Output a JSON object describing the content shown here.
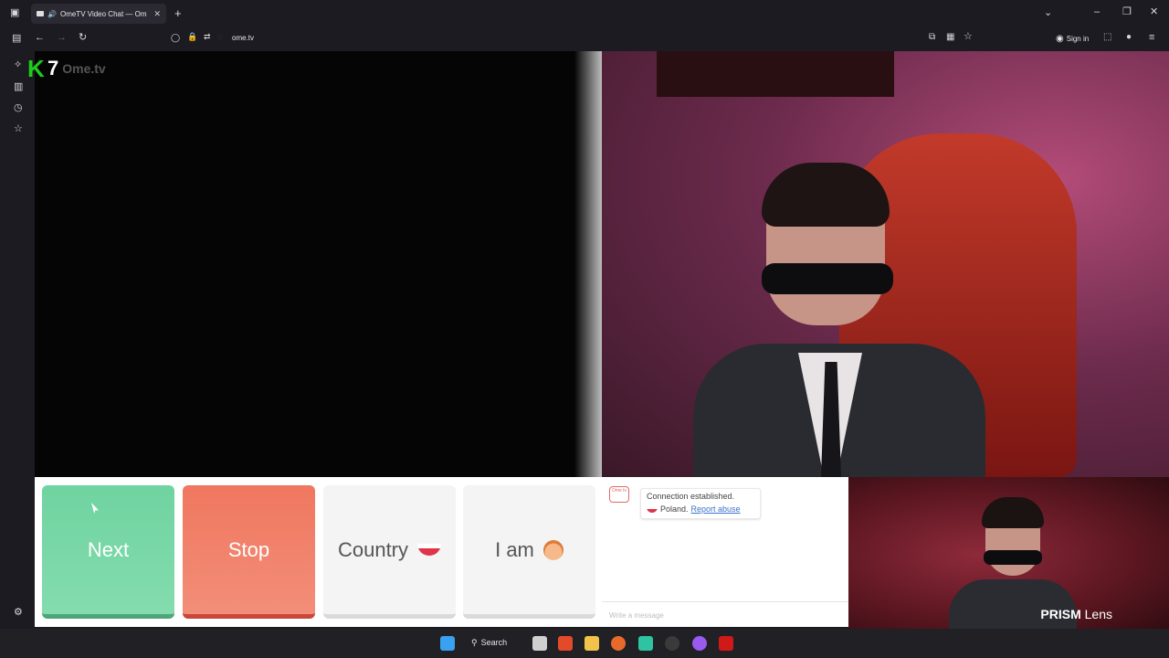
{
  "browser": {
    "tab_title": "OmeTV Video Chat — Om",
    "tab_close": "✕",
    "new_tab": "+",
    "url": "ome.tv",
    "signin_label": "Sign in"
  },
  "logo": {
    "k": "K",
    "seven": "7",
    "ome": "Ome.tv"
  },
  "controls": {
    "next_label": "Next",
    "stop_label": "Stop",
    "country_label": "Country",
    "iam_label": "I am"
  },
  "chat": {
    "logo_text": "Ome tv",
    "status": "Connection established.",
    "country": "Poland.",
    "report_link": "Report abuse",
    "input_placeholder": "Write a message"
  },
  "self_video": {
    "brand": "PRISM",
    "brand_suffix": "Lens"
  },
  "taskbar": {
    "search_label": "Search"
  },
  "colors": {
    "next": "#6fd3a0",
    "stop": "#f0775f",
    "link": "#3a73c9"
  }
}
